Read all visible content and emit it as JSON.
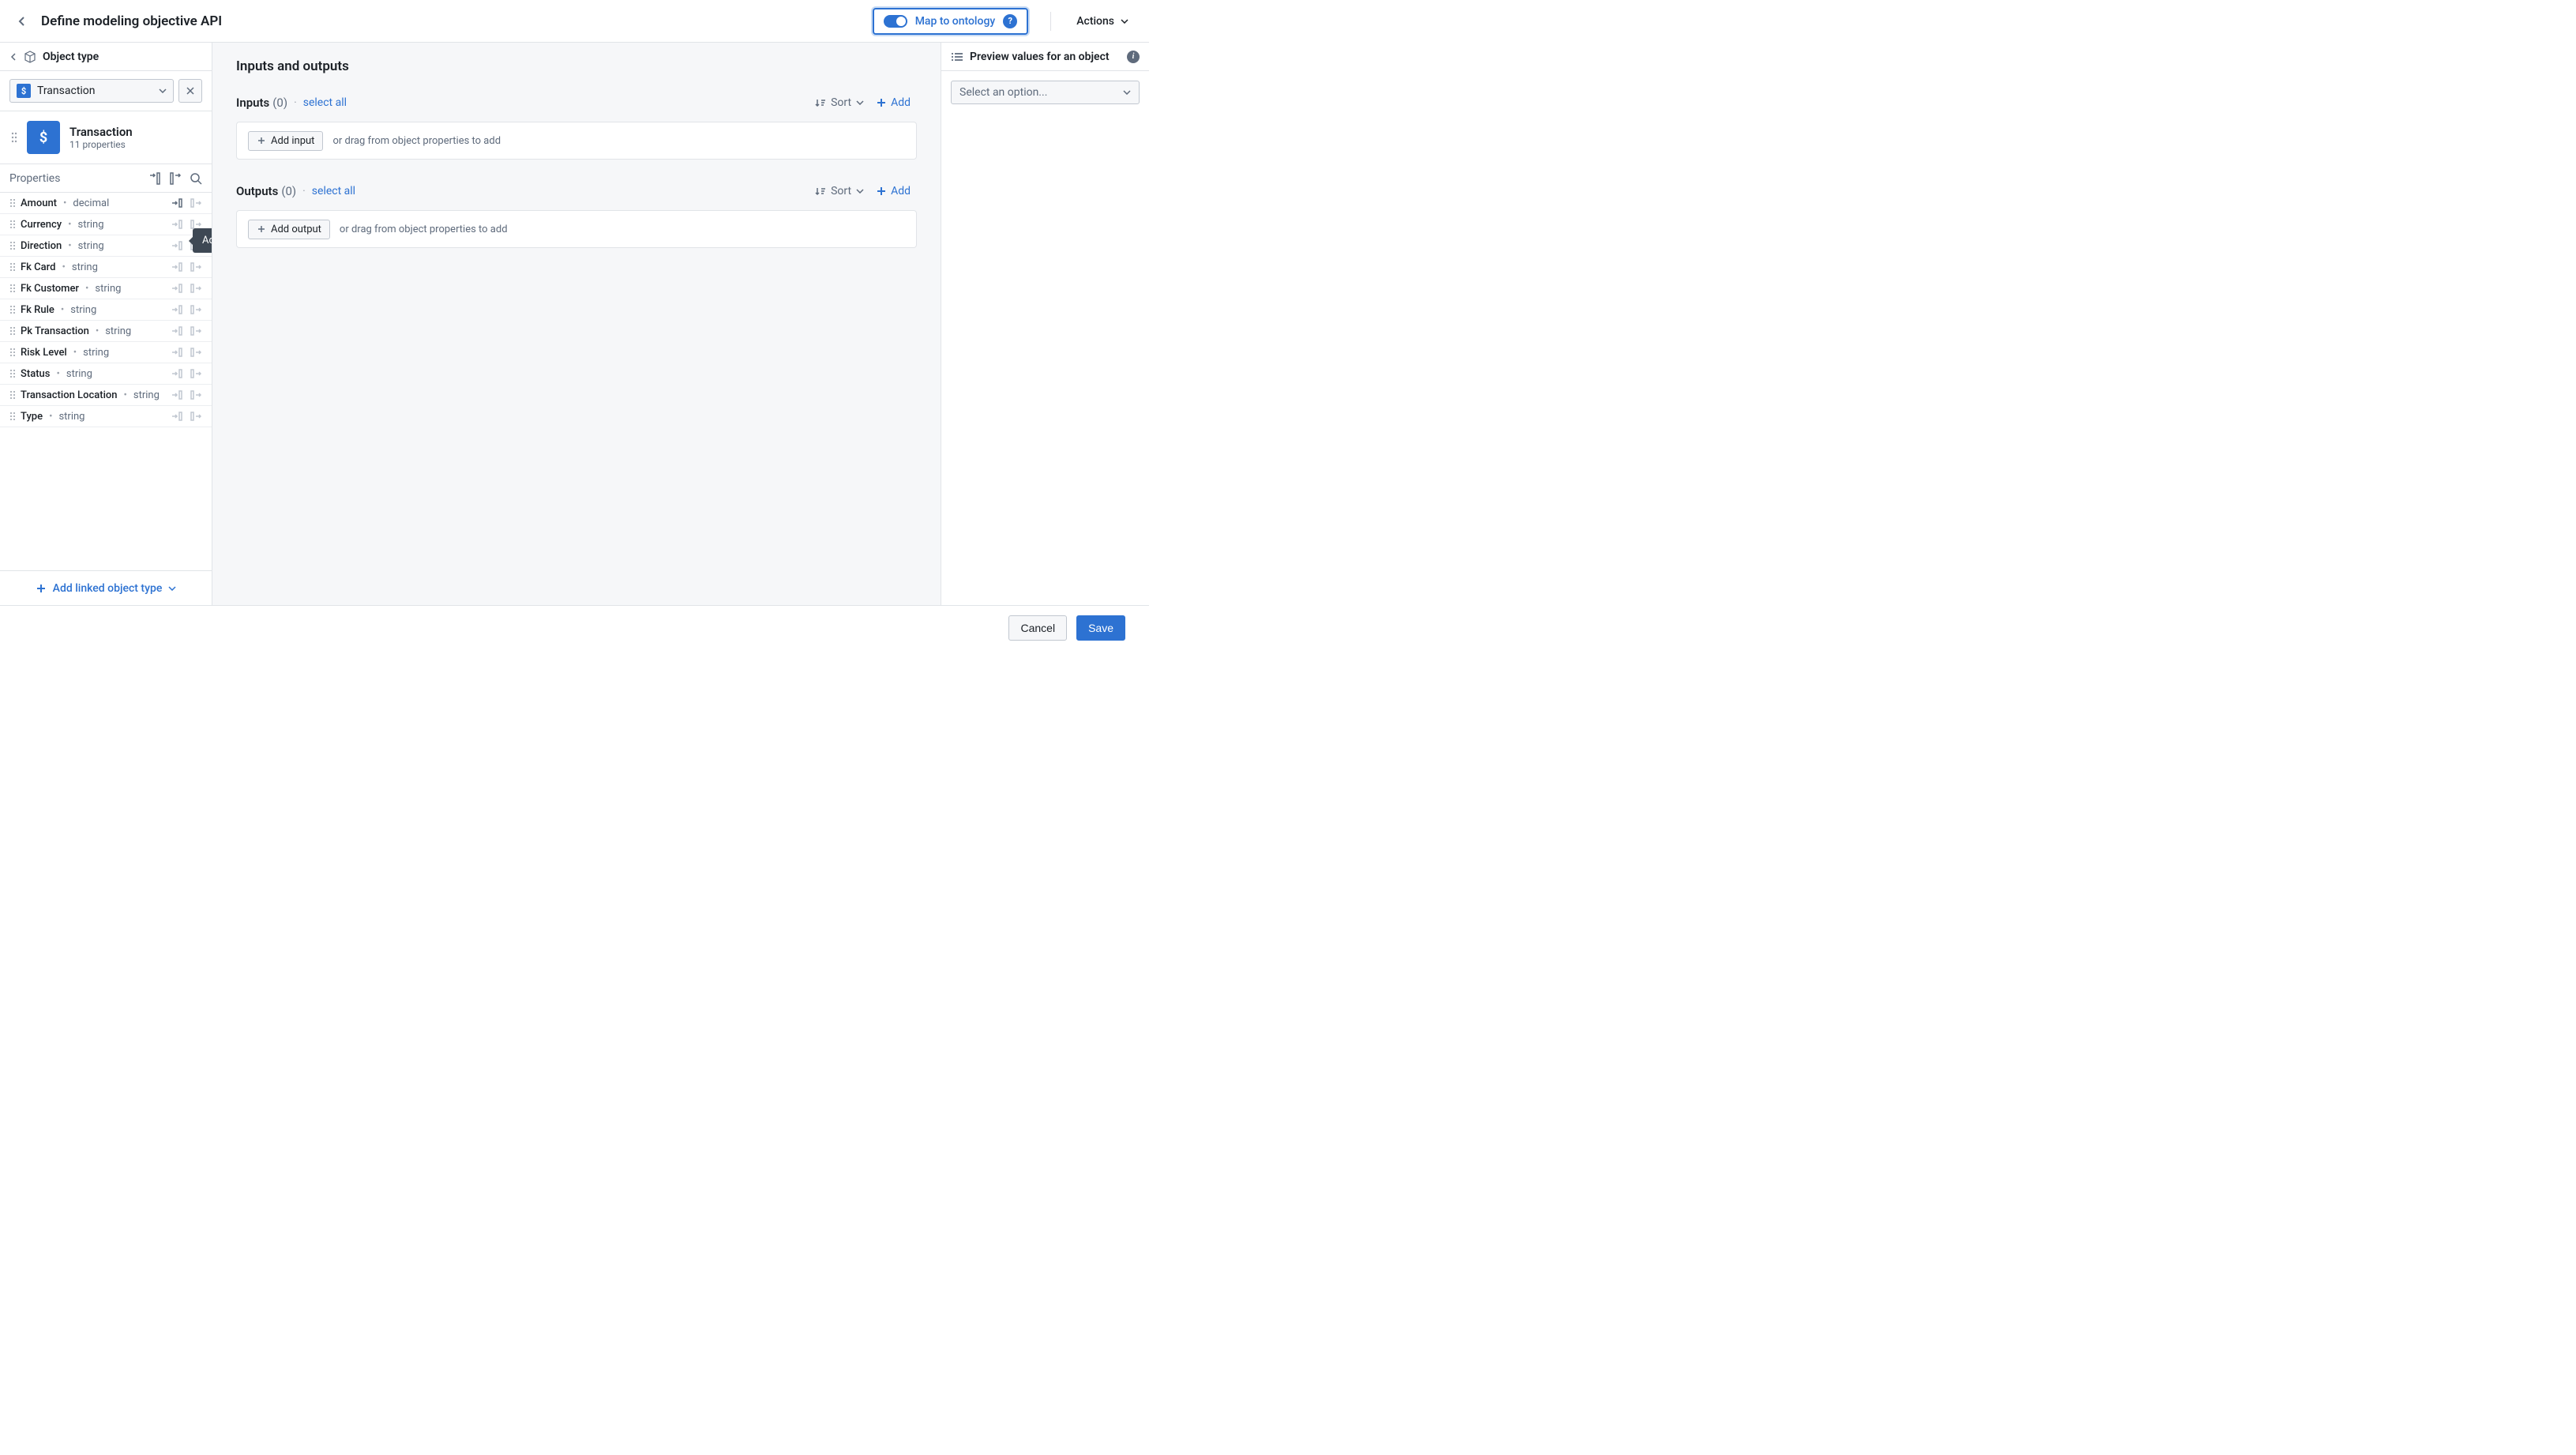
{
  "header": {
    "title": "Define modeling objective API",
    "map_to_ontology": "Map to ontology",
    "actions": "Actions"
  },
  "left_panel": {
    "object_type_label": "Object type",
    "selected_object": "Transaction",
    "object_card": {
      "name": "Transaction",
      "subtitle": "11 properties"
    },
    "properties_label": "Properties",
    "properties": [
      {
        "name": "Amount",
        "type": "decimal"
      },
      {
        "name": "Currency",
        "type": "string"
      },
      {
        "name": "Direction",
        "type": "string"
      },
      {
        "name": "Fk Card",
        "type": "string"
      },
      {
        "name": "Fk Customer",
        "type": "string"
      },
      {
        "name": "Fk Rule",
        "type": "string"
      },
      {
        "name": "Pk Transaction",
        "type": "string"
      },
      {
        "name": "Risk Level",
        "type": "string"
      },
      {
        "name": "Status",
        "type": "string"
      },
      {
        "name": "Transaction Location",
        "type": "string"
      },
      {
        "name": "Type",
        "type": "string"
      }
    ],
    "tooltip": "Add this object property to Inputs",
    "add_linked": "Add linked object type"
  },
  "center_panel": {
    "title": "Inputs and outputs",
    "inputs": {
      "label": "Inputs",
      "count": "(0)",
      "select_all": "select all",
      "sort": "Sort",
      "add": "Add",
      "add_input": "Add input",
      "hint": "or drag from object properties to add"
    },
    "outputs": {
      "label": "Outputs",
      "count": "(0)",
      "select_all": "select all",
      "sort": "Sort",
      "add": "Add",
      "add_output": "Add output",
      "hint": "or drag from object properties to add"
    }
  },
  "right_panel": {
    "header": "Preview values for an object",
    "select_placeholder": "Select an option..."
  },
  "footer": {
    "cancel": "Cancel",
    "save": "Save"
  }
}
